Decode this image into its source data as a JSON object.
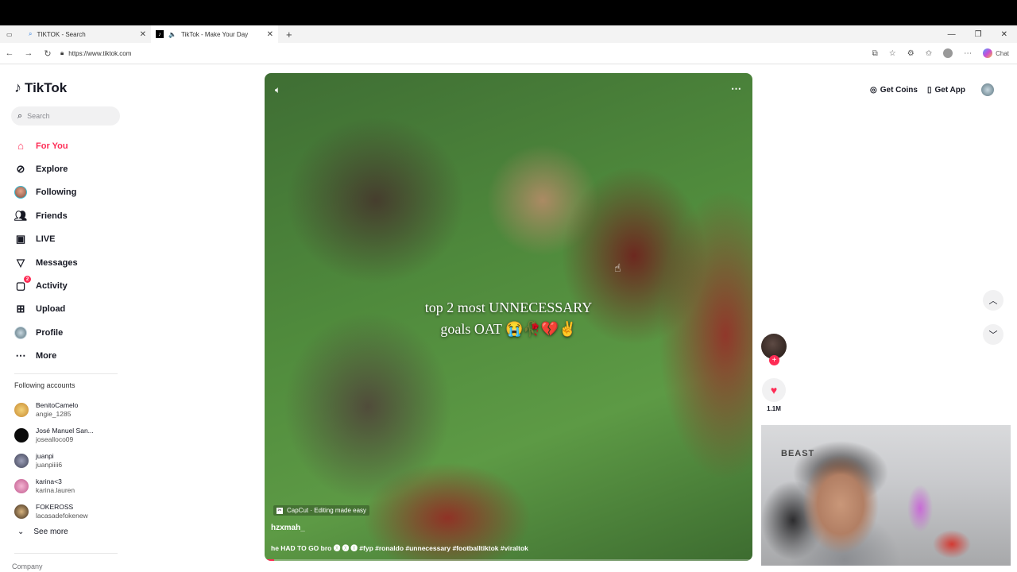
{
  "browser": {
    "tabs": [
      {
        "label": "TIKTOK - Search",
        "active": false
      },
      {
        "label": "TikTok - Make Your Day",
        "active": true
      }
    ],
    "url": "https://www.tiktok.com",
    "chat_label": "Chat"
  },
  "app": {
    "name": "TikTok",
    "search_placeholder": "Search"
  },
  "nav": {
    "items": [
      {
        "label": "For You",
        "icon": "home-icon",
        "active": true
      },
      {
        "label": "Explore",
        "icon": "compass-icon"
      },
      {
        "label": "Following",
        "icon": "following-avatar"
      },
      {
        "label": "Friends",
        "icon": "friends-icon"
      },
      {
        "label": "LIVE",
        "icon": "live-icon"
      },
      {
        "label": "Messages",
        "icon": "messages-icon"
      },
      {
        "label": "Activity",
        "icon": "activity-icon",
        "badge": "2"
      },
      {
        "label": "Upload",
        "icon": "upload-icon"
      },
      {
        "label": "Profile",
        "icon": "profile-avatar"
      },
      {
        "label": "More",
        "icon": "more-dots-icon"
      }
    ]
  },
  "following_accounts": {
    "title": "Following accounts",
    "accounts": [
      {
        "name": "BenitoCamelo",
        "handle": "angie_1285",
        "color": "#e6b24a"
      },
      {
        "name": "José Manuel San...",
        "handle": "josealloco09",
        "color": "#0a0a0a"
      },
      {
        "name": "juanpi",
        "handle": "juanpiiii6",
        "color": "#6c6f8a"
      },
      {
        "name": "karina<3",
        "handle": "karina.lauren",
        "color": "#e07aa8"
      },
      {
        "name": "FOKEROSS",
        "handle": "lacasadefokenew",
        "color": "#8a6d45"
      }
    ],
    "see_more": "See more"
  },
  "footer": {
    "company": "Company"
  },
  "header": {
    "get_coins": "Get Coins",
    "get_app": "Get App"
  },
  "video": {
    "caption_line1": "top 2 most UNNECESSARY",
    "caption_line2": "goals OAT 😭🥀💔✌️",
    "capcut": "CapCut · Editing made easy",
    "author": "hzxmah_",
    "description": "he HAD TO GO bro 🅧 🅧 🅧 #fyp #ronaldo #unnecessary #footballtiktok #viraltok",
    "progress": 0.02,
    "likes": "1.1M"
  },
  "webcam": {
    "poster_text": "BEAST"
  },
  "colors": {
    "accent": "#fe2c55",
    "text": "#161823"
  }
}
